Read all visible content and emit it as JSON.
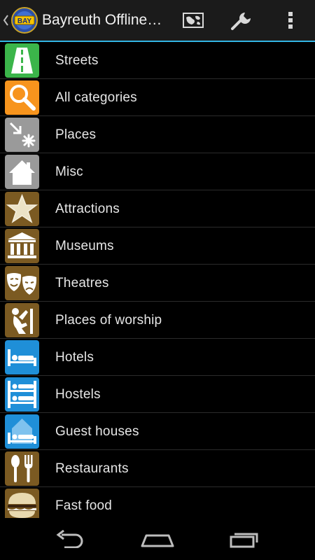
{
  "actionbar": {
    "logo_text": "BAY",
    "title": "Bayreuth Offline City Map"
  },
  "colors": {
    "actionbar_underline": "#33b5e5",
    "green": "#3bb54a",
    "orange": "#f7941d",
    "gray": "#9a9a9a",
    "brown": "#7b5a22",
    "blue": "#1f8fd8"
  },
  "categories": [
    {
      "label": "Streets",
      "icon": "road-icon",
      "color": "green"
    },
    {
      "label": "All categories",
      "icon": "search-icon",
      "color": "orange"
    },
    {
      "label": "Places",
      "icon": "places-icon",
      "color": "gray"
    },
    {
      "label": "Misc",
      "icon": "house-icon",
      "color": "gray"
    },
    {
      "label": "Attractions",
      "icon": "star-icon",
      "color": "brown"
    },
    {
      "label": "Museums",
      "icon": "museum-icon",
      "color": "brown"
    },
    {
      "label": "Theatres",
      "icon": "theatre-masks-icon",
      "color": "brown"
    },
    {
      "label": "Places of worship",
      "icon": "praying-person-icon",
      "color": "brown"
    },
    {
      "label": "Hotels",
      "icon": "bed-icon",
      "color": "blue"
    },
    {
      "label": "Hostels",
      "icon": "bunk-bed-icon",
      "color": "blue"
    },
    {
      "label": "Guest houses",
      "icon": "guest-house-icon",
      "color": "blue"
    },
    {
      "label": "Restaurants",
      "icon": "fork-spoon-icon",
      "color": "brown"
    },
    {
      "label": "Fast food",
      "icon": "burger-icon",
      "color": "brown"
    }
  ]
}
